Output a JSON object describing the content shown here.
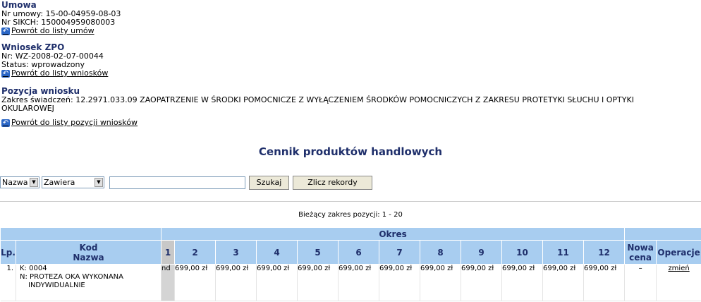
{
  "umowa": {
    "title": "Umowa",
    "nr_umowy": "Nr umowy: 15-00-04959-08-03",
    "nr_sikch": "Nr SIKCH: 150004959080003",
    "back_label": "Powrót do listy umów"
  },
  "wniosek": {
    "title": "Wniosek ZPO",
    "nr": "Nr: WZ-2008-02-07-00044",
    "status": "Status: wprowadzony",
    "back_label": "Powrót do listy wniosków"
  },
  "pozycja": {
    "title": "Pozycja wniosku",
    "zakres_line1": "Zakres świadczeń: 12.2971.033.09 ZAOPATRZENIE W ŚRODKI POMOCNICZE Z WYŁĄCZENIEM ŚRODKÓW POMOCNICZYCH Z ZAKRESU PROTETYKI SŁUCHU I OPTYKI",
    "zakres_line2": "OKULAROWEJ",
    "back_label": "Powrót do listy pozycji wniosków"
  },
  "page_title": "Cennik produktów handlowych",
  "search": {
    "field_select": "Nazwa",
    "condition_select": "Zawiera",
    "value": "",
    "search_button": "Szukaj",
    "count_button": "Zlicz rekordy"
  },
  "range_text": "Bieżący zakres pozycji: 1 - 20",
  "table": {
    "header": {
      "lp": "Lp.",
      "kod": "Kod",
      "nazwa": "Nazwa",
      "okres": "Okres",
      "periods": [
        "1",
        "2",
        "3",
        "4",
        "5",
        "6",
        "7",
        "8",
        "9",
        "10",
        "11",
        "12"
      ],
      "nowa": "Nowa",
      "cena": "cena",
      "operacje": "Operacje"
    },
    "rows": [
      {
        "lp": "1.",
        "kod_prefix": "K:",
        "kod": "0004",
        "nazwa_prefix": "N:",
        "nazwa_line1": "PROTEZA OKA WYKONANA",
        "nazwa_line2": "INDYWIDUALNIE",
        "prices": [
          "nd",
          "699,00 zł",
          "699,00 zł",
          "699,00 zł",
          "699,00 zł",
          "699,00 zł",
          "699,00 zł",
          "699,00 zł",
          "699,00 zł",
          "699,00 zł",
          "699,00 zł",
          "699,00 zł"
        ],
        "nowa_cena": "–",
        "operacja": "zmień"
      }
    ]
  },
  "colors": {
    "header_bg": "#a8cdf0",
    "title": "#1f2f6b",
    "back_icon": "#2a66c6"
  }
}
